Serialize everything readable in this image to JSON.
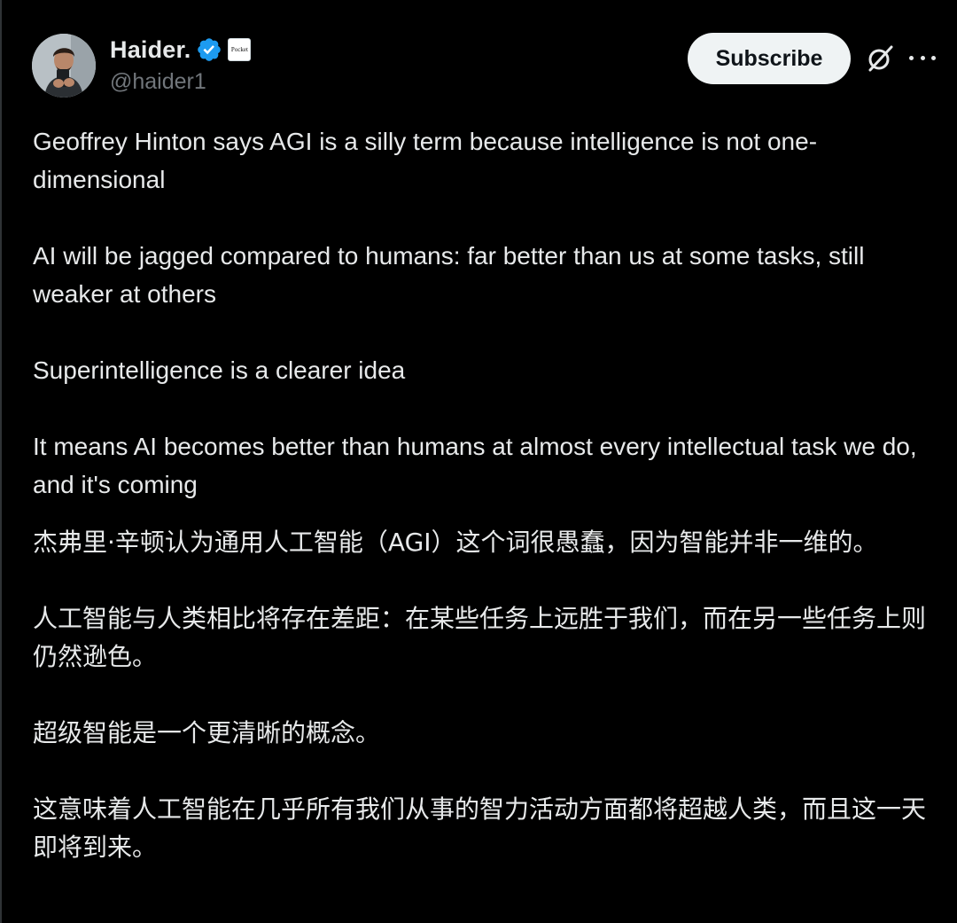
{
  "author": {
    "display_name": "Haider.",
    "handle": "@haider1",
    "verified_icon": "verified-badge-icon",
    "affiliation_badge": "Pocket",
    "avatar": "avatar-photo"
  },
  "actions": {
    "subscribe_label": "Subscribe",
    "grok_icon": "grok-icon",
    "more_icon": "more-options-icon"
  },
  "post": {
    "en_paragraphs": [
      "Geoffrey Hinton says AGI is a silly term because intelligence is not one-dimensional",
      "AI will be jagged compared to humans: far better than us at some tasks, still weaker at others",
      "Superintelligence is a clearer idea",
      "It means AI becomes better than humans at almost every intellectual task we do, and it's coming"
    ],
    "zh_paragraphs": [
      "杰弗里·辛顿认为通用人工智能（AGI）这个词很愚蠢，因为智能并非一维的。",
      "人工智能与人类相比将存在差距：在某些任务上远胜于我们，而在另一些任务上则仍然逊色。",
      "超级智能是一个更清晰的概念。",
      "这意味着人工智能在几乎所有我们从事的智力活动方面都将超越人类，而且这一天即将到来。"
    ]
  },
  "colors": {
    "background": "#000000",
    "text": "#e7e9ea",
    "secondary_text": "#71767b",
    "verified_blue": "#1d9bf0",
    "button_bg": "#eff3f4"
  }
}
